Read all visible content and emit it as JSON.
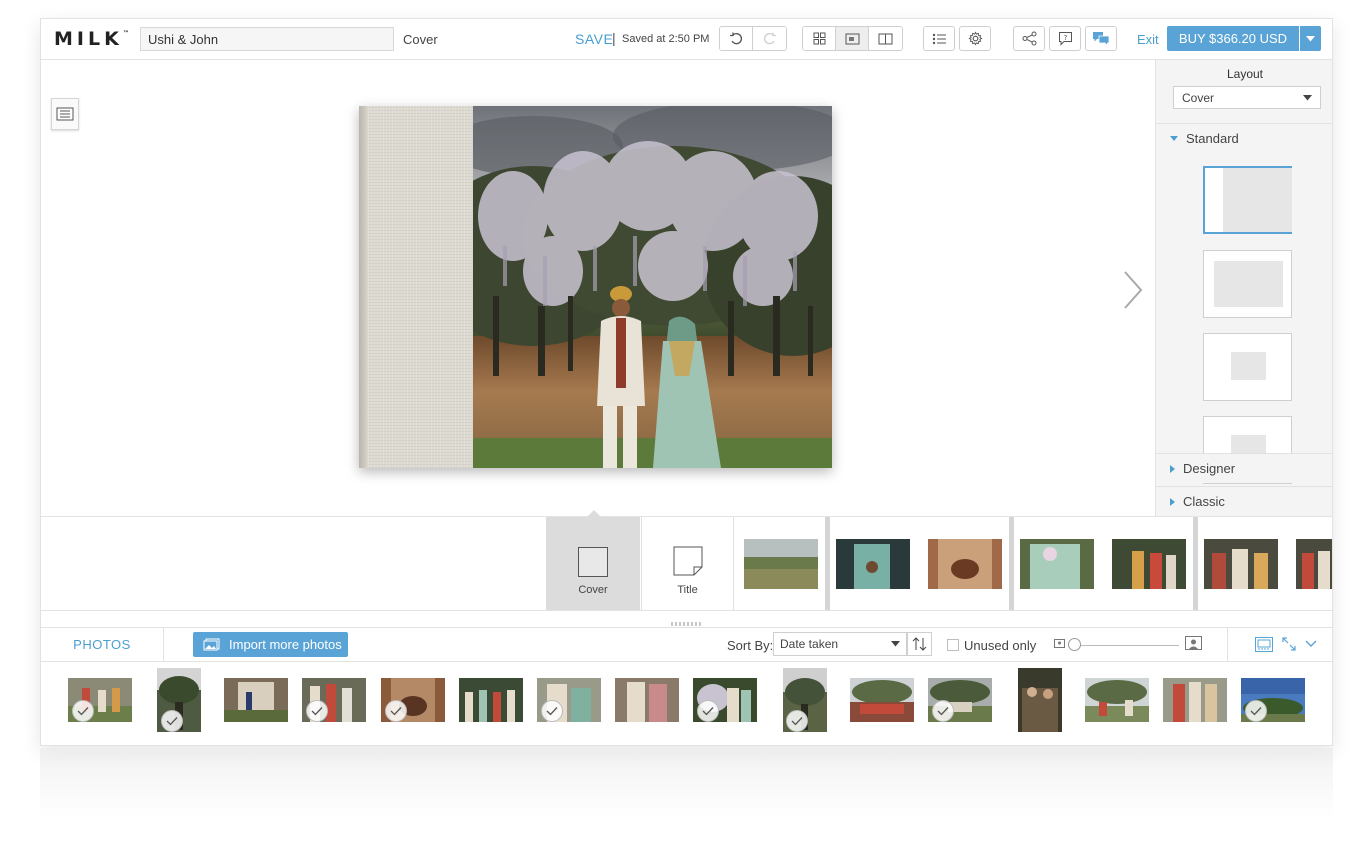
{
  "header": {
    "logo": "MILK",
    "logo_tm": "™",
    "project_name": "Ushi & John",
    "current_page": "Cover",
    "save_label": "SAVE",
    "separator": "|",
    "saved_status": "Saved at 2:50 PM",
    "exit_label": "Exit",
    "buy_label": "BUY $366.20 USD"
  },
  "layout_panel": {
    "title": "Layout",
    "selected": "Cover",
    "sections": [
      "Standard",
      "Designer",
      "Classic"
    ]
  },
  "page_strip": {
    "cover_label": "Cover",
    "title_label": "Title"
  },
  "photos_bar": {
    "tab_label": "PHOTOS",
    "import_label": "Import more photos",
    "sort_label": "Sort By:",
    "sort_value": "Date taken",
    "unused_label": "Unused only"
  },
  "colors": {
    "accent": "#5aa3d6",
    "link": "#4a9fd1"
  }
}
